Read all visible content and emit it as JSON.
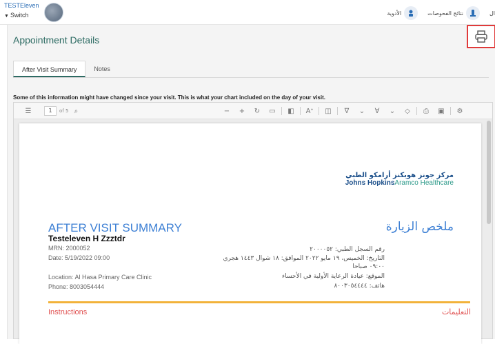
{
  "topbar": {
    "user_name": "TESTEleven",
    "switch_label": "Switch",
    "right_items": [
      {
        "label": "الأدوية"
      },
      {
        "label": "نتائج الفحوصات"
      },
      {
        "label": "ال"
      }
    ]
  },
  "page": {
    "title": "Appointment Details",
    "tabs": [
      {
        "label": "After Visit Summary",
        "active": true
      },
      {
        "label": "Notes",
        "active": false
      }
    ],
    "info_text": "Some of this information might have changed since your visit. This is what your chart included on the day of your visit."
  },
  "viewer": {
    "page_number": "1",
    "page_total": "of 5"
  },
  "document": {
    "logo_ar": "مركز جونز هوبكنز أرامكو الطبي",
    "logo_en_jh": "Johns Hopkins",
    "logo_en_ah": "Aramco Healthcare",
    "title_en": "AFTER VISIT SUMMARY",
    "title_ar": "ملخص الزيارة",
    "patient_name": "Testeleven H Zzztdr",
    "mrn": "MRN: 2000052",
    "date": "Date: 5/19/2022 09:00",
    "location": "Location: Al Hasa Primary Care Clinic",
    "phone": "Phone: 8003054444",
    "mrn_ar": "رقم السجل الطبي: ٢٠٠٠٠٥٢",
    "date_ar": "التاريخ: الخميس، ١٩ مايو ٢٠٢٢ الموافق: ١٨ شوال ١٤٤٣ هجري",
    "time_ar": "٠٩:٠٠ صباحا",
    "location_ar": "الموقع: عيادة الرعاية الأولية في الأحساء",
    "phone_ar": "هاتف: ٨٠٠٣٠٥٤٤٤٤",
    "instructions_en": "Instructions",
    "instructions_ar": "التعليمات"
  },
  "colors": {
    "title_green": "#2d6b63",
    "link_blue": "#3c7fd4",
    "print_highlight": "#e03a3a",
    "instructions_red": "#e05252",
    "rule_orange": "#f2b23a"
  }
}
